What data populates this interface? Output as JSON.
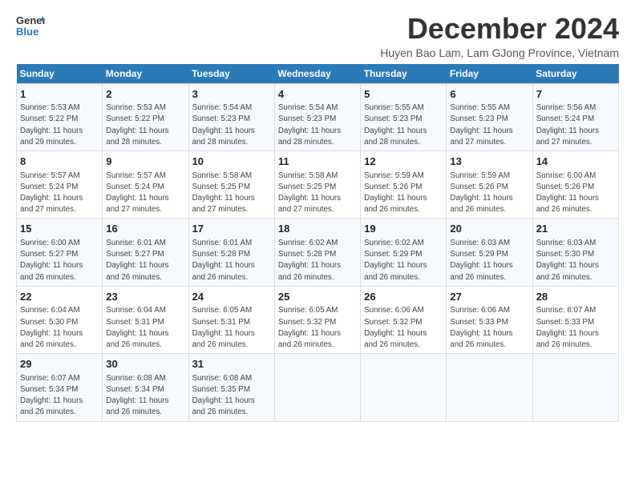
{
  "logo": {
    "general": "General",
    "blue": "Blue"
  },
  "title": "December 2024",
  "subtitle": "Huyen Bao Lam, Lam GJong Province, Vietnam",
  "days_of_week": [
    "Sunday",
    "Monday",
    "Tuesday",
    "Wednesday",
    "Thursday",
    "Friday",
    "Saturday"
  ],
  "weeks": [
    [
      {
        "day": "1",
        "info": "Sunrise: 5:53 AM\nSunset: 5:22 PM\nDaylight: 11 hours\nand 29 minutes."
      },
      {
        "day": "2",
        "info": "Sunrise: 5:53 AM\nSunset: 5:22 PM\nDaylight: 11 hours\nand 28 minutes."
      },
      {
        "day": "3",
        "info": "Sunrise: 5:54 AM\nSunset: 5:23 PM\nDaylight: 11 hours\nand 28 minutes."
      },
      {
        "day": "4",
        "info": "Sunrise: 5:54 AM\nSunset: 5:23 PM\nDaylight: 11 hours\nand 28 minutes."
      },
      {
        "day": "5",
        "info": "Sunrise: 5:55 AM\nSunset: 5:23 PM\nDaylight: 11 hours\nand 28 minutes."
      },
      {
        "day": "6",
        "info": "Sunrise: 5:55 AM\nSunset: 5:23 PM\nDaylight: 11 hours\nand 27 minutes."
      },
      {
        "day": "7",
        "info": "Sunrise: 5:56 AM\nSunset: 5:24 PM\nDaylight: 11 hours\nand 27 minutes."
      }
    ],
    [
      {
        "day": "8",
        "info": "Sunrise: 5:57 AM\nSunset: 5:24 PM\nDaylight: 11 hours\nand 27 minutes."
      },
      {
        "day": "9",
        "info": "Sunrise: 5:57 AM\nSunset: 5:24 PM\nDaylight: 11 hours\nand 27 minutes."
      },
      {
        "day": "10",
        "info": "Sunrise: 5:58 AM\nSunset: 5:25 PM\nDaylight: 11 hours\nand 27 minutes."
      },
      {
        "day": "11",
        "info": "Sunrise: 5:58 AM\nSunset: 5:25 PM\nDaylight: 11 hours\nand 27 minutes."
      },
      {
        "day": "12",
        "info": "Sunrise: 5:59 AM\nSunset: 5:26 PM\nDaylight: 11 hours\nand 26 minutes."
      },
      {
        "day": "13",
        "info": "Sunrise: 5:59 AM\nSunset: 5:26 PM\nDaylight: 11 hours\nand 26 minutes."
      },
      {
        "day": "14",
        "info": "Sunrise: 6:00 AM\nSunset: 5:26 PM\nDaylight: 11 hours\nand 26 minutes."
      }
    ],
    [
      {
        "day": "15",
        "info": "Sunrise: 6:00 AM\nSunset: 5:27 PM\nDaylight: 11 hours\nand 26 minutes."
      },
      {
        "day": "16",
        "info": "Sunrise: 6:01 AM\nSunset: 5:27 PM\nDaylight: 11 hours\nand 26 minutes."
      },
      {
        "day": "17",
        "info": "Sunrise: 6:01 AM\nSunset: 5:28 PM\nDaylight: 11 hours\nand 26 minutes."
      },
      {
        "day": "18",
        "info": "Sunrise: 6:02 AM\nSunset: 5:28 PM\nDaylight: 11 hours\nand 26 minutes."
      },
      {
        "day": "19",
        "info": "Sunrise: 6:02 AM\nSunset: 5:29 PM\nDaylight: 11 hours\nand 26 minutes."
      },
      {
        "day": "20",
        "info": "Sunrise: 6:03 AM\nSunset: 5:29 PM\nDaylight: 11 hours\nand 26 minutes."
      },
      {
        "day": "21",
        "info": "Sunrise: 6:03 AM\nSunset: 5:30 PM\nDaylight: 11 hours\nand 26 minutes."
      }
    ],
    [
      {
        "day": "22",
        "info": "Sunrise: 6:04 AM\nSunset: 5:30 PM\nDaylight: 11 hours\nand 26 minutes."
      },
      {
        "day": "23",
        "info": "Sunrise: 6:04 AM\nSunset: 5:31 PM\nDaylight: 11 hours\nand 26 minutes."
      },
      {
        "day": "24",
        "info": "Sunrise: 6:05 AM\nSunset: 5:31 PM\nDaylight: 11 hours\nand 26 minutes."
      },
      {
        "day": "25",
        "info": "Sunrise: 6:05 AM\nSunset: 5:32 PM\nDaylight: 11 hours\nand 26 minutes."
      },
      {
        "day": "26",
        "info": "Sunrise: 6:06 AM\nSunset: 5:32 PM\nDaylight: 11 hours\nand 26 minutes."
      },
      {
        "day": "27",
        "info": "Sunrise: 6:06 AM\nSunset: 5:33 PM\nDaylight: 11 hours\nand 26 minutes."
      },
      {
        "day": "28",
        "info": "Sunrise: 6:07 AM\nSunset: 5:33 PM\nDaylight: 11 hours\nand 26 minutes."
      }
    ],
    [
      {
        "day": "29",
        "info": "Sunrise: 6:07 AM\nSunset: 5:34 PM\nDaylight: 11 hours\nand 26 minutes."
      },
      {
        "day": "30",
        "info": "Sunrise: 6:08 AM\nSunset: 5:34 PM\nDaylight: 11 hours\nand 26 minutes."
      },
      {
        "day": "31",
        "info": "Sunrise: 6:08 AM\nSunset: 5:35 PM\nDaylight: 11 hours\nand 26 minutes."
      },
      {
        "day": "",
        "info": ""
      },
      {
        "day": "",
        "info": ""
      },
      {
        "day": "",
        "info": ""
      },
      {
        "day": "",
        "info": ""
      }
    ]
  ]
}
